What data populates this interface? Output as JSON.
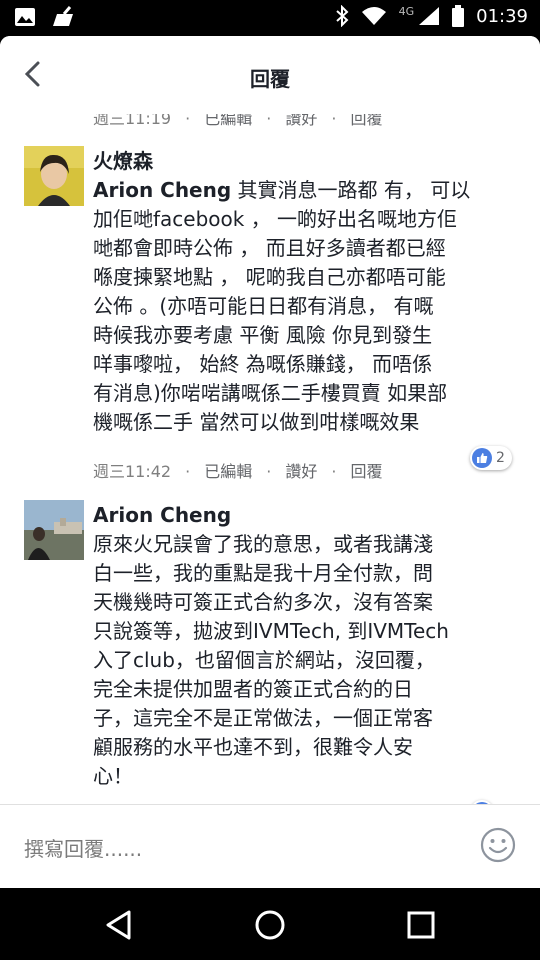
{
  "status": {
    "network": "4G",
    "time": "01:39"
  },
  "header": {
    "title": "回覆"
  },
  "prev_meta": {
    "time": "週三11:19",
    "edited": "已編輯",
    "like": "讚好",
    "reply": "回覆"
  },
  "comments": [
    {
      "author": "火燎森",
      "mention": "Arion Cheng",
      "text_lines": [
        " 其實消息一路都 有， 可以",
        "加佢哋facebook ， 一啲好出名嘅地方佢",
        "哋都會即時公佈 ， 而且好多讀者都已經",
        "喺度揀緊地點 ， 呢啲我自己亦都唔可能",
        "公佈 。(亦唔可能日日都有消息， 有嘅",
        "時候我亦要考慮 平衡 風險 你見到發生",
        "咩事嚟啦， 始終 為嘅係賺錢， 而唔係",
        "有消息)你啱啱講嘅係二手樓買賣 如果部",
        "機嘅係二手 當然可以做到咁樣嘅效果"
      ],
      "time": "週三11:42",
      "edited": "已編輯",
      "like": "讚好",
      "reply": "回覆",
      "reaction_count": "2"
    },
    {
      "author": "Arion Cheng",
      "text_lines": [
        "原來火兄誤會了我的意思，或者我講淺",
        "白一些，我的重點是我十月全付款，問",
        "天機幾時可簽正式合約多次，沒有答案",
        "只說簽等，拋波到IVMTech, 到IVMTech",
        "入了club，也留個言於網站，沒回覆，",
        "完全未提供加盟者的簽正式合約的日",
        "子，這完全不是正常做法，一個正常客",
        "顧服務的水平也達不到，很難令人安",
        "心！"
      ]
    }
  ],
  "composer": {
    "placeholder": "撰寫回覆......"
  },
  "colors": {
    "accent": "#4c7fe2",
    "text": "#1d2129",
    "meta": "#7f7f7f"
  }
}
